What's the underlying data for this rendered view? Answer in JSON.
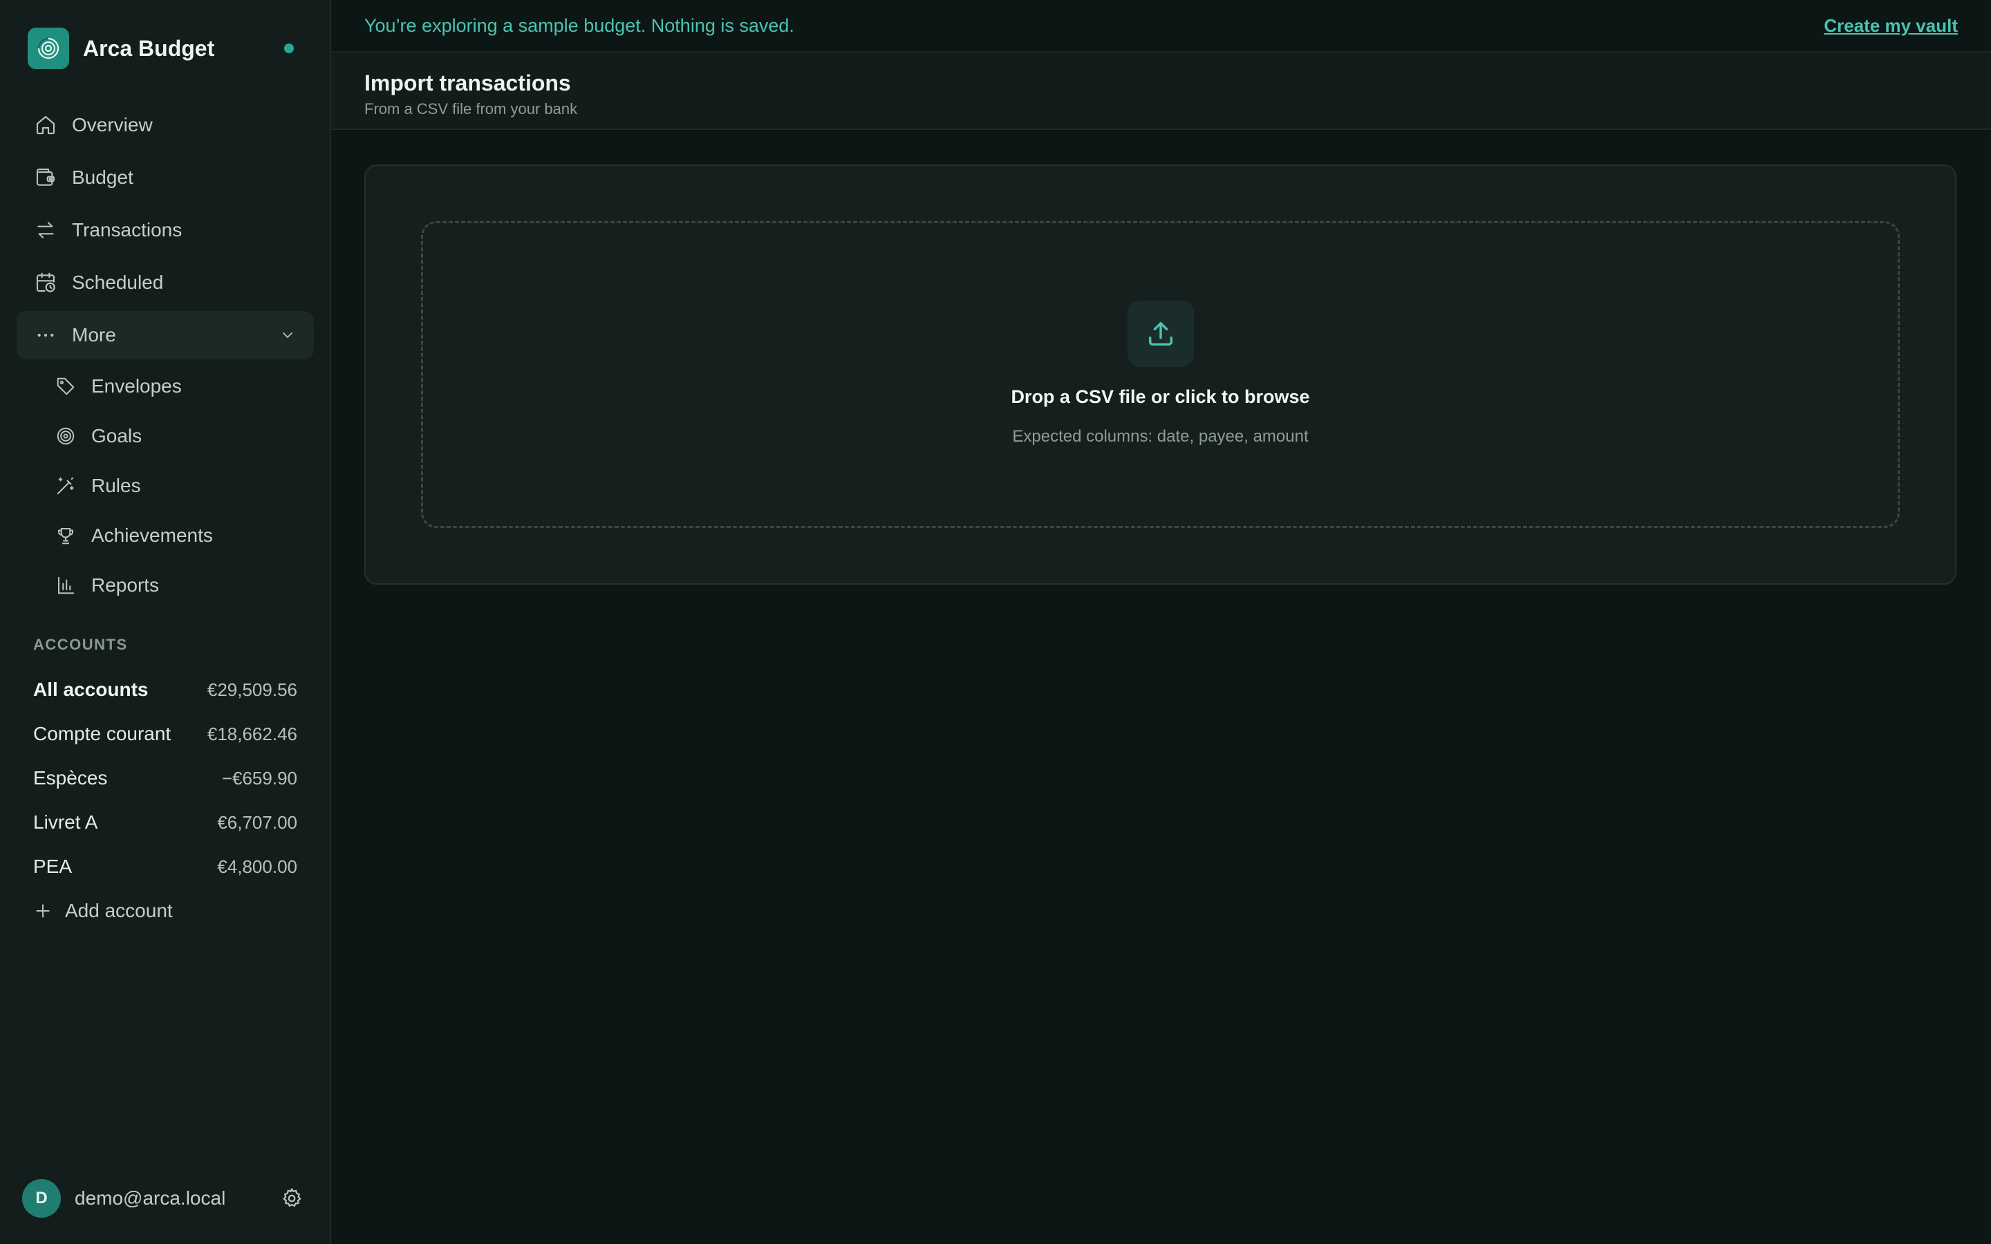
{
  "app": {
    "name": "Arca Budget"
  },
  "nav": {
    "items": [
      {
        "label": "Overview",
        "icon": "home-icon"
      },
      {
        "label": "Budget",
        "icon": "wallet-icon"
      },
      {
        "label": "Transactions",
        "icon": "arrows-swap-icon"
      },
      {
        "label": "Scheduled",
        "icon": "calendar-clock-icon"
      }
    ],
    "more": {
      "label": "More",
      "icon": "dots-icon",
      "expanded": true
    },
    "sub_items": [
      {
        "label": "Envelopes",
        "icon": "tag-icon"
      },
      {
        "label": "Goals",
        "icon": "target-icon"
      },
      {
        "label": "Rules",
        "icon": "magic-wand-icon"
      },
      {
        "label": "Achievements",
        "icon": "trophy-icon"
      },
      {
        "label": "Reports",
        "icon": "bar-chart-icon"
      }
    ]
  },
  "accounts": {
    "heading": "ACCOUNTS",
    "items": [
      {
        "name": "All accounts",
        "amount": "€29,509.56"
      },
      {
        "name": "Compte courant",
        "amount": "€18,662.46"
      },
      {
        "name": "Espèces",
        "amount": "−€659.90"
      },
      {
        "name": "Livret A",
        "amount": "€6,707.00"
      },
      {
        "name": "PEA",
        "amount": "€4,800.00"
      }
    ],
    "add_label": "Add account"
  },
  "user": {
    "initial": "D",
    "email": "demo@arca.local"
  },
  "banner": {
    "text": "You’re exploring a sample budget. Nothing is saved.",
    "link": "Create my vault"
  },
  "page": {
    "title": "Import transactions",
    "subtitle": "From a CSV file from your bank"
  },
  "dropzone": {
    "title": "Drop a CSV file or click to browse",
    "hint": "Expected columns: date, payee, amount"
  },
  "colors": {
    "accent": "#4cc3b0",
    "brand": "#1f8f80",
    "background": "#0c1614",
    "sidebar": "#131e1c"
  }
}
